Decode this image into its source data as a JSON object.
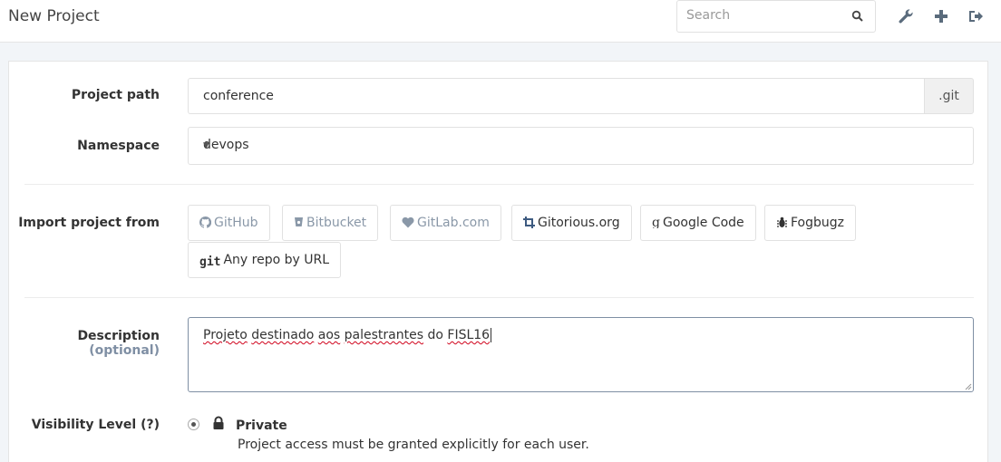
{
  "header": {
    "title": "New Project",
    "search_placeholder": "Search",
    "icons": [
      "wrench-icon",
      "plus-icon",
      "sign-out-icon"
    ]
  },
  "form": {
    "project_path": {
      "label": "Project path",
      "value": "conference",
      "addon": ".git"
    },
    "namespace": {
      "label": "Namespace",
      "value": "devops"
    },
    "import": {
      "label": "Import project from",
      "buttons": [
        {
          "label": "GitHub",
          "icon": "github-icon",
          "enabled": false
        },
        {
          "label": "Bitbucket",
          "icon": "bitbucket-icon",
          "enabled": false
        },
        {
          "label": "GitLab.com",
          "icon": "heart-icon",
          "enabled": false
        },
        {
          "label": "Gitorious.org",
          "icon": "crop-icon",
          "enabled": true
        },
        {
          "label": "Google Code",
          "icon": "google-icon",
          "enabled": true
        },
        {
          "label": "Fogbugz",
          "icon": "bug-icon",
          "enabled": true
        },
        {
          "label": "Any repo by URL",
          "icon": "git-icon",
          "icon_text": "git",
          "enabled": true
        }
      ]
    },
    "description": {
      "label": "Description",
      "optional": "(optional)",
      "value_words": [
        "Projeto",
        "destinado",
        "aos",
        "palestrantes",
        "do",
        "FISL16"
      ]
    },
    "visibility": {
      "label": "Visibility Level (?)",
      "option_title": "Private",
      "option_desc": "Project access must be granted explicitly for each user."
    }
  },
  "colors": {
    "muted_text": "#8a98a8",
    "panel_bg": "#ffffff",
    "page_bg": "#f2f5f8",
    "spellcheck": "#d0021b"
  }
}
